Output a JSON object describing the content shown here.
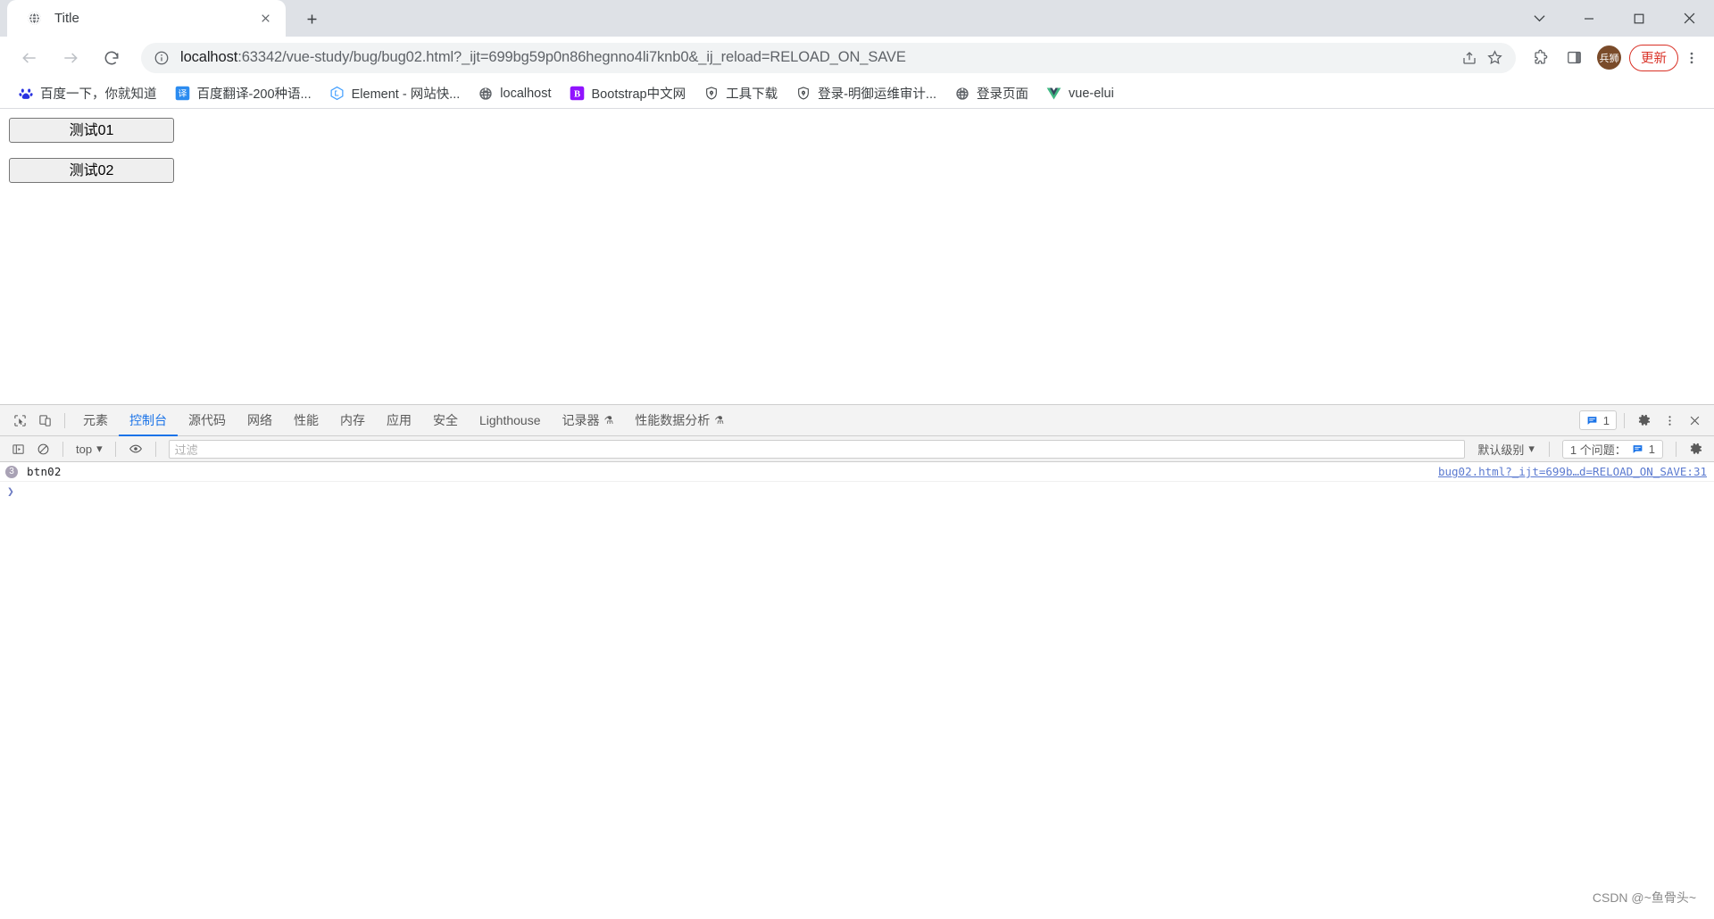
{
  "browser": {
    "tab": {
      "title": "Title",
      "favicon": "globe-icon",
      "close": "×"
    },
    "new_tab_label": "+",
    "window_controls": {
      "list": "⌄",
      "minimize": "–",
      "maximize": "□",
      "close": "✕"
    },
    "nav": {
      "back": "←",
      "forward": "→",
      "reload": "↻"
    },
    "omnibox": {
      "info_icon": "info-circle-icon",
      "url_host": "localhost",
      "url_rest": ":63342/vue-study/bug/bug02.html?_ijt=699bg59p0n86hegnno4li7knb0&_ij_reload=RELOAD_ON_SAVE",
      "url_full": "localhost:63342/vue-study/bug/bug02.html?_ijt=699bg59p0n86hegnno4li7knb0&_ij_reload=RELOAD_ON_SAVE",
      "share_icon": "share-icon",
      "bookmark_icon": "star-icon"
    },
    "toolbar_right": {
      "extensions_icon": "puzzle-icon",
      "sidepanel_icon": "side-panel-icon",
      "avatar_label": "兵狮",
      "update_label": "更新",
      "menu_icon": "kebab-menu-icon"
    },
    "bookmarks": [
      {
        "label": "百度一下，你就知道",
        "icon": "baidu-paw-icon",
        "glyph": "爱",
        "color": "#2932e1"
      },
      {
        "label": "百度翻译-200种语...",
        "icon": "baidu-translate-icon",
        "glyph": "译",
        "color": "#2c8cf0"
      },
      {
        "label": "Element - 网站快...",
        "icon": "element-ui-icon",
        "glyph": "Ⓔ",
        "color": "#409eff"
      },
      {
        "label": "localhost",
        "icon": "globe-icon",
        "glyph": "◉",
        "color": "#5f6368"
      },
      {
        "label": "Bootstrap中文网",
        "icon": "bootstrap-icon",
        "glyph": "B",
        "color": "#7952b3"
      },
      {
        "label": "工具下载",
        "icon": "shield-icon",
        "glyph": "⛉",
        "color": "#3c4043"
      },
      {
        "label": "登录-明御运维审计...",
        "icon": "shield-icon",
        "glyph": "⛉",
        "color": "#3c4043"
      },
      {
        "label": "登录页面",
        "icon": "globe-icon",
        "glyph": "◉",
        "color": "#5f6368"
      },
      {
        "label": "vue-elui",
        "icon": "vue-icon",
        "glyph": "V",
        "color": "#41b883"
      }
    ]
  },
  "page": {
    "buttons": [
      {
        "label": "测试01",
        "name": "test-01-button"
      },
      {
        "label": "测试02",
        "name": "test-02-button"
      }
    ]
  },
  "devtools": {
    "inspect_icon": "inspect-element-icon",
    "device_icon": "device-toolbar-icon",
    "tabs": [
      {
        "label": "元素",
        "active": false,
        "flask": ""
      },
      {
        "label": "控制台",
        "active": true,
        "flask": ""
      },
      {
        "label": "源代码",
        "active": false,
        "flask": ""
      },
      {
        "label": "网络",
        "active": false,
        "flask": ""
      },
      {
        "label": "性能",
        "active": false,
        "flask": ""
      },
      {
        "label": "内存",
        "active": false,
        "flask": ""
      },
      {
        "label": "应用",
        "active": false,
        "flask": ""
      },
      {
        "label": "安全",
        "active": false,
        "flask": ""
      },
      {
        "label": "Lighthouse",
        "active": false,
        "flask": ""
      },
      {
        "label": "记录器",
        "active": false,
        "flask": "⚗"
      },
      {
        "label": "性能数据分析",
        "active": false,
        "flask": "⚗"
      }
    ],
    "topbar_right": {
      "messages_count": "1",
      "messages_icon": "message-badge-icon",
      "settings_icon": "gear-icon",
      "more_icon": "kebab-menu-icon",
      "close_icon": "close-icon"
    },
    "filterbar": {
      "sidebar_icon": "console-sidebar-icon",
      "clear_icon": "clear-console-icon",
      "context": "top",
      "context_caret": "▾",
      "eye_icon": "live-expression-eye-icon",
      "filter_placeholder": "过滤",
      "filter_value": "",
      "level": "默认级别",
      "level_caret": "▾",
      "issues_label": "1 个问题：",
      "issues_count": "1",
      "settings_icon": "gear-icon"
    },
    "console": {
      "entries": [
        {
          "badge": "3",
          "message": "btn02",
          "source": "bug02.html?_ijt=699b…d=RELOAD_ON_SAVE:31"
        }
      ],
      "prompt": "❯"
    }
  },
  "watermark": "CSDN @~鱼骨头~",
  "colors": {
    "accent": "#1a73e8",
    "tabstrip_bg": "#dee1e6",
    "devtools_bg": "#f3f3f3",
    "update_red": "#d93025"
  }
}
